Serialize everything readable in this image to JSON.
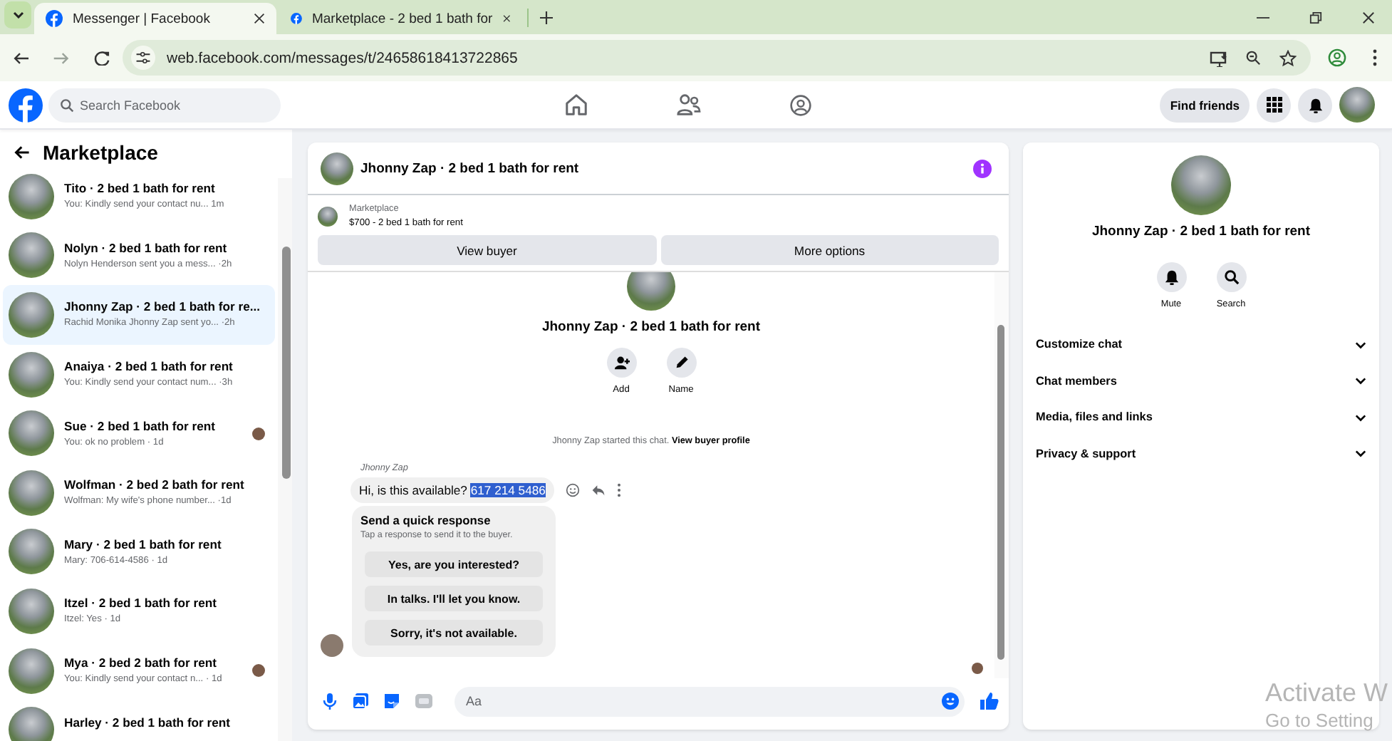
{
  "browser": {
    "tabs": [
      {
        "title": "Messenger | Facebook",
        "selected": true
      },
      {
        "title": "Marketplace - 2 bed 1 bath for",
        "selected": false
      }
    ],
    "url": "web.facebook.com/messages/t/24658618413722865"
  },
  "header": {
    "search_placeholder": "Search Facebook",
    "find_friends": "Find friends"
  },
  "sidebar": {
    "title": "Marketplace",
    "conversations": [
      {
        "title": "Tito · 2 bed 1 bath for rent",
        "preview": "You: Kindly send your contact nu... ",
        "time": "1m",
        "selected": false,
        "seen": false
      },
      {
        "title": "Nolyn · 2 bed 1 bath for rent",
        "preview": "Nolyn Henderson sent you a mess...",
        "time": "·2h",
        "selected": false,
        "seen": false
      },
      {
        "title": "Jhonny Zap · 2 bed 1 bath for re...",
        "preview": "Rachid Monika Jhonny Zap sent yo...",
        "time": "·2h",
        "selected": true,
        "seen": false
      },
      {
        "title": "Anaiya · 2 bed 1 bath for rent",
        "preview": "You: Kindly send your contact num...",
        "time": "·3h",
        "selected": false,
        "seen": false
      },
      {
        "title": "Sue · 2 bed 1 bath for rent",
        "preview": "You: ok no problem",
        "time": "· 1d",
        "selected": false,
        "seen": true
      },
      {
        "title": "Wolfman · 2 bed 2 bath for rent",
        "preview": "Wolfman: My wife's phone number...",
        "time": "·1d",
        "selected": false,
        "seen": false
      },
      {
        "title": "Mary · 2 bed 1 bath for rent",
        "preview": "Mary: 706-614-4586",
        "time": "· 1d",
        "selected": false,
        "seen": false
      },
      {
        "title": "Itzel · 2 bed 1 bath for rent",
        "preview": "Itzel: Yes",
        "time": "· 1d",
        "selected": false,
        "seen": false
      },
      {
        "title": "Mya · 2 bed 2 bath for rent",
        "preview": "You: Kindly send your contact n...",
        "time": "· 1d",
        "selected": false,
        "seen": true
      },
      {
        "title": "Harley · 2 bed 1 bath for rent",
        "selected": false,
        "seen": false
      }
    ]
  },
  "chat": {
    "title": "Jhonny Zap · 2 bed 1 bath for rent",
    "listing": {
      "label": "Marketplace",
      "detail": "$700 - 2 bed 1 bath for rent"
    },
    "buttons": [
      "View buyer",
      "More options"
    ],
    "profile": {
      "name": "Jhonny Zap · 2 bed 1 bath for rent",
      "actions": [
        "Add",
        "Name"
      ]
    },
    "started": {
      "text": "Jhonny Zap started this chat.",
      "link": "View buyer profile"
    },
    "message": {
      "sender": "Jhonny Zap",
      "text": "Hi, is this available?",
      "selected_text": "617 214 5486"
    },
    "quick_response": {
      "title": "Send a quick response",
      "subtitle": "Tap a response to send it to the buyer.",
      "options": [
        "Yes, are you interested?",
        "In talks. I'll let you know.",
        "Sorry, it's not available."
      ]
    },
    "composer": {
      "placeholder": "Aa"
    }
  },
  "info": {
    "name": "Jhonny Zap · 2 bed 1 bath for rent",
    "actions": [
      "Mute",
      "Search"
    ],
    "sections": [
      "Customize chat",
      "Chat members",
      "Media, files and links",
      "Privacy & support"
    ]
  },
  "os_notice": [
    "Activate W",
    "Go to Setting"
  ]
}
